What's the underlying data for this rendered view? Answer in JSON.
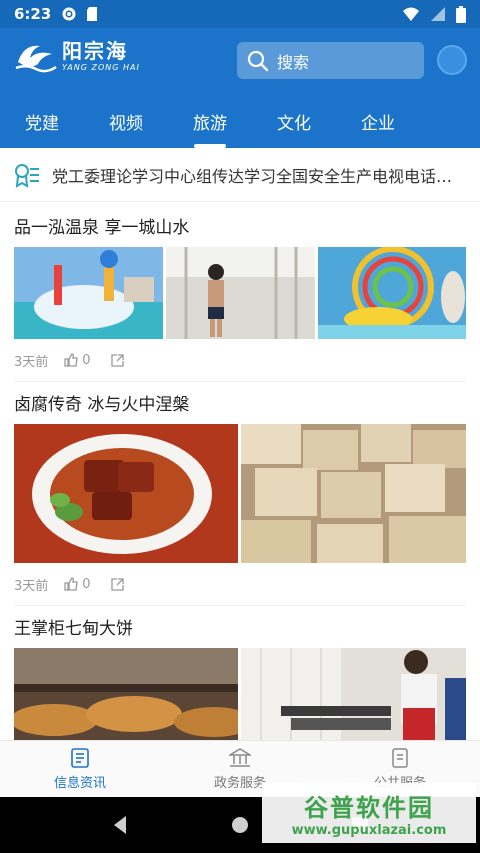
{
  "status_bar": {
    "time": "6:23"
  },
  "header": {
    "logo_cn": "阳宗海",
    "logo_en": "YANG ZONG HAI",
    "search_placeholder": "搜索"
  },
  "tabs": [
    {
      "label": "党建"
    },
    {
      "label": "视频"
    },
    {
      "label": "旅游",
      "active": true
    },
    {
      "label": "文化"
    },
    {
      "label": "企业"
    }
  ],
  "notice": {
    "text": "党工委理论学习中心组传达学习全国安全生产电视电话会议精神"
  },
  "articles": [
    {
      "title": "品一泓温泉 享一城山水",
      "time": "3天前",
      "likes": "0"
    },
    {
      "title": "卤腐传奇 冰与火中涅槃",
      "time": "3天前",
      "likes": "0"
    },
    {
      "title": "王掌柜七甸大饼"
    }
  ],
  "bottom_nav": [
    {
      "label": "信息资讯",
      "active": true
    },
    {
      "label": "政务服务"
    },
    {
      "label": "公共服务"
    }
  ],
  "watermark": {
    "cn": "谷普软件园",
    "url": "www.gupuxlazai.com"
  },
  "colors": {
    "brand_blue": "#1b74c9",
    "status_blue": "#1669b8"
  }
}
